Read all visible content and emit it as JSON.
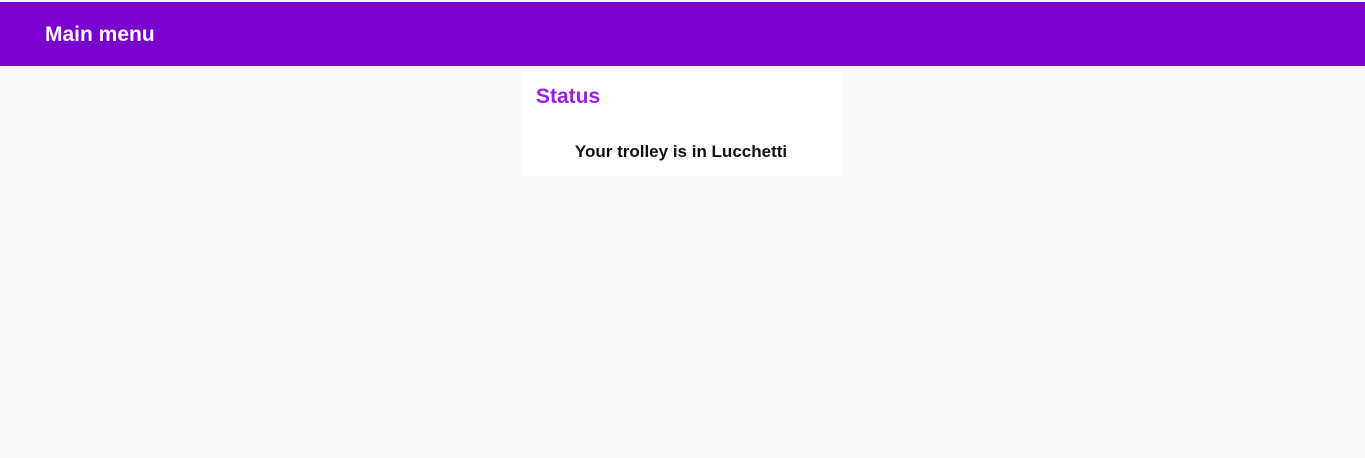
{
  "header": {
    "title": "Main menu",
    "background_color": "#7b00cf"
  },
  "status_card": {
    "title": "Status",
    "title_color": "#9b1ee8",
    "message": "Your trolley is in Lucchetti"
  }
}
